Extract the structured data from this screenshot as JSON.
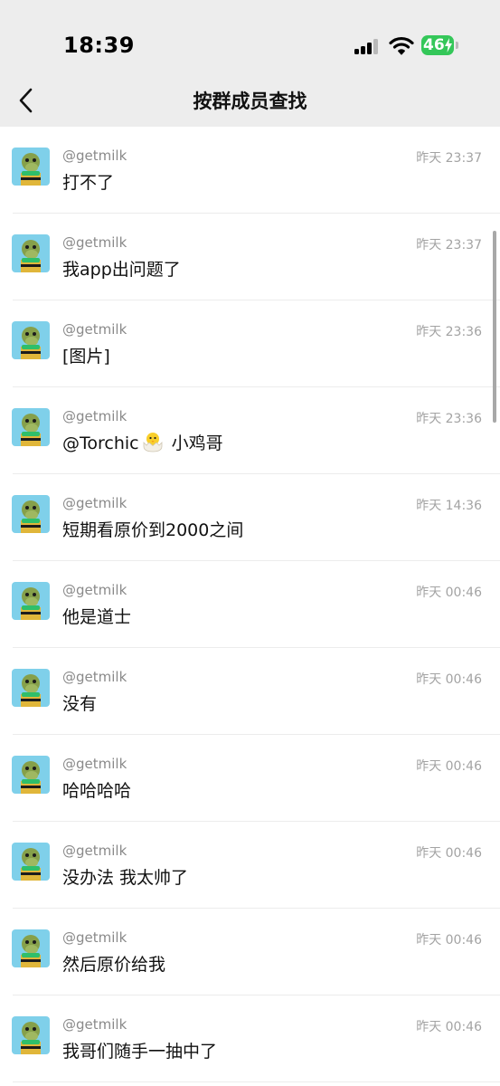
{
  "status_bar": {
    "time": "18:39",
    "battery": "46"
  },
  "header": {
    "title": "按群成员查找"
  },
  "messages": [
    {
      "name": "@getmilk",
      "time": "昨天 23:37",
      "text": "打不了"
    },
    {
      "name": "@getmilk",
      "time": "昨天 23:37",
      "text": "我app出问题了"
    },
    {
      "name": "@getmilk",
      "time": "昨天 23:36",
      "text": "[图片]"
    },
    {
      "name": "@getmilk",
      "time": "昨天 23:36",
      "text_before": "@Torchic",
      "text_after": " 小鸡哥",
      "emoji": "hatching-chick-icon"
    },
    {
      "name": "@getmilk",
      "time": "昨天 14:36",
      "text": "短期看原价到2000之间"
    },
    {
      "name": "@getmilk",
      "time": "昨天 00:46",
      "text": "他是道士"
    },
    {
      "name": "@getmilk",
      "time": "昨天 00:46",
      "text": "没有"
    },
    {
      "name": "@getmilk",
      "time": "昨天 00:46",
      "text": "哈哈哈哈"
    },
    {
      "name": "@getmilk",
      "time": "昨天 00:46",
      "text": "没办法 我太帅了"
    },
    {
      "name": "@getmilk",
      "time": "昨天 00:46",
      "text": "然后原价给我"
    },
    {
      "name": "@getmilk",
      "time": "昨天 00:46",
      "text": "我哥们随手一抽中了"
    }
  ],
  "colors": {
    "header_bg": "#ededed",
    "battery": "#34c759",
    "avatar_bg": "#7fd0ea"
  }
}
